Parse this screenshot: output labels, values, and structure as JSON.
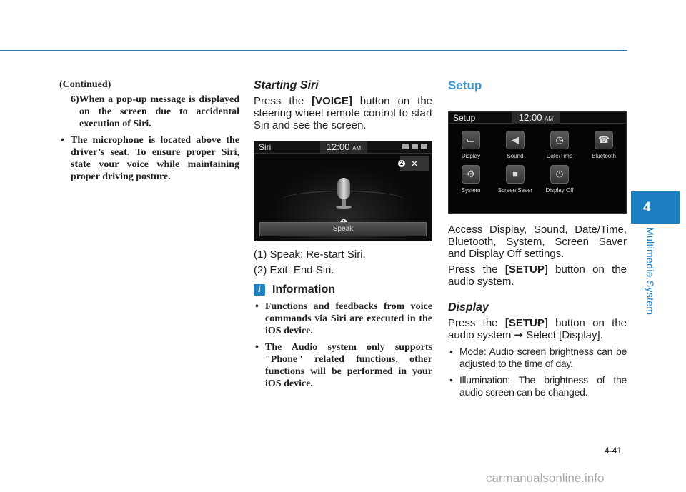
{
  "col1": {
    "continued": "(Continued)",
    "item6": "6)When a pop-up message is displayed on the screen due to accidental execution of Siri.",
    "bullet": "The microphone is located above the driver’s seat. To ensure proper Siri, state your voice while maintaining proper driving posture."
  },
  "col2": {
    "heading": "Starting Siri",
    "intro_pre": "Press the ",
    "intro_bold": "[VOICE]",
    "intro_post": " button on the steering wheel remote control to start Siri and see the screen.",
    "screen": {
      "title": "Siri",
      "clock": "12:00",
      "ampm": "AM",
      "close_glyph": "✕",
      "speak_label": "Speak",
      "callout1": "1",
      "callout2": "2"
    },
    "legend": [
      "(1) Speak: Re-start Siri.",
      "(2) Exit: End Siri."
    ],
    "info": {
      "icon": "i",
      "title": "Information",
      "bullets": [
        "Functions and feedbacks from voice commands via Siri are executed in the iOS device.",
        "The Audio system only supports \"Phone\" related functions, other functions will be performed in your iOS device."
      ]
    }
  },
  "col3": {
    "heading": "Setup",
    "screen": {
      "title": "Setup",
      "clock": "12:00",
      "ampm": "AM",
      "tiles": [
        {
          "label": "Display",
          "icon": "display-icon",
          "glyph": "▭"
        },
        {
          "label": "Sound",
          "icon": "speaker-icon",
          "glyph": "◀"
        },
        {
          "label": "Date/Time",
          "icon": "clock-icon",
          "glyph": "◷"
        },
        {
          "label": "Bluetooth",
          "icon": "bluetooth-phone-icon",
          "glyph": "☎"
        },
        {
          "label": "System",
          "icon": "gear-icon",
          "glyph": "⚙"
        },
        {
          "label": "Screen Saver",
          "icon": "screen-saver-icon",
          "glyph": "■"
        },
        {
          "label": "Display Off",
          "icon": "display-off-icon",
          "glyph": "⏻"
        }
      ]
    },
    "p1": "Access Display, Sound, Date/Time, Bluetooth, System, Screen Saver and Display Off settings.",
    "p2_pre": "Press the ",
    "p2_bold": "[SETUP]",
    "p2_post": " button on the audio system.",
    "subheading": "Display",
    "p3_pre": "Press the ",
    "p3_bold": "[SETUP]",
    "p3_post": " button on the audio system ➞ Select [Display].",
    "bullets": [
      "Mode: Audio screen brightness can be adjusted to the time of day.",
      "Illumination: The brightness of the audio screen can be changed."
    ]
  },
  "side_tab": {
    "number": "4",
    "label": "Multimedia System"
  },
  "page_number": "4-41",
  "watermark": "carmanualsonline.info",
  "colors": {
    "accent": "#1b7fc1",
    "setup_heading": "#3b9ad4"
  }
}
